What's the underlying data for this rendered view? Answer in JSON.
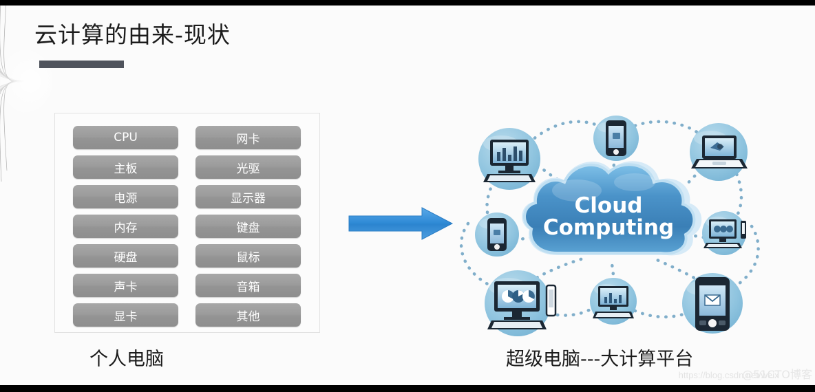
{
  "slide": {
    "title": "云计算的由来-现状",
    "background_color": "#fbfbfb",
    "accent_color": "#4f535c"
  },
  "left_panel": {
    "caption": "个人电脑",
    "columns": [
      {
        "items": [
          "CPU",
          "主板",
          "电源",
          "内存",
          "硬盘",
          "声卡",
          "显卡"
        ]
      },
      {
        "items": [
          "网卡",
          "光驱",
          "显示器",
          "键盘",
          "鼠标",
          "音箱",
          "其他"
        ]
      }
    ],
    "pill_color": "#9c9c9c",
    "pill_text_color": "#ffffff"
  },
  "arrow": {
    "direction": "right",
    "color": "#2e8bdc",
    "icon": "right-arrow-icon"
  },
  "right_panel": {
    "caption": "超级电脑---大计算平台",
    "cloud": {
      "line1": "Cloud",
      "line2": "Computing",
      "fill_color": "#3f86c0",
      "glow_color": "#cfe6f5",
      "text_color": "#ffffff"
    },
    "nodes": [
      {
        "id": "node-desktop-bar-chart",
        "icon": "desktop-computer-icon",
        "label": "desktop with bar chart",
        "position": "top-left"
      },
      {
        "id": "node-smartphone-top",
        "icon": "smartphone-icon",
        "label": "smartphone",
        "position": "top-center"
      },
      {
        "id": "node-laptop",
        "icon": "laptop-icon",
        "label": "laptop",
        "position": "top-right"
      },
      {
        "id": "node-smartphone-left",
        "icon": "smartphone-icon",
        "label": "smartphone",
        "position": "middle-left"
      },
      {
        "id": "node-desktop-small-right",
        "icon": "desktop-computer-icon",
        "label": "desktop computer",
        "position": "middle-right"
      },
      {
        "id": "node-desktop-pie-chart",
        "icon": "desktop-computer-icon",
        "label": "desktop with pie charts",
        "position": "bottom-left"
      },
      {
        "id": "node-desktop-bottom",
        "icon": "desktop-computer-icon",
        "label": "desktop with bar chart",
        "position": "bottom-center"
      },
      {
        "id": "node-tablet-mail",
        "icon": "tablet-mail-icon",
        "label": "tablet with mail",
        "position": "bottom-right"
      }
    ],
    "node_circle_color": "#8cc2dd",
    "connector_style": "dotted"
  },
  "watermark": {
    "url": "https://blog.csdn.net/weix",
    "brand": "@51CTO博客"
  }
}
